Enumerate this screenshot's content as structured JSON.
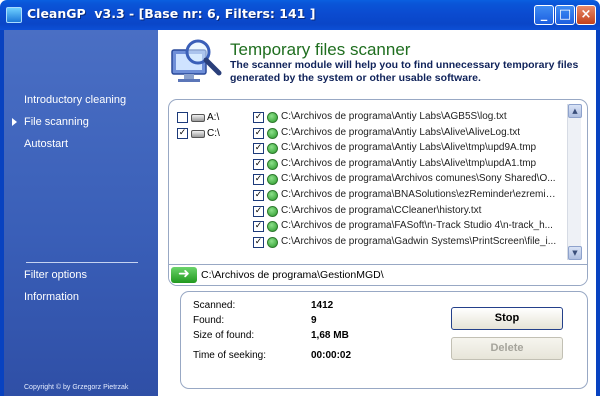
{
  "window": {
    "title": "CleanGP  v3.3 - [Base nr: 6, Filters: 141 ]",
    "min_label": "_",
    "max_label": "□",
    "close_label": "×"
  },
  "sidebar": {
    "items": [
      {
        "label": "Introductory cleaning",
        "active": false
      },
      {
        "label": "File scanning",
        "active": true
      },
      {
        "label": "Autostart",
        "active": false
      }
    ],
    "bottom_items": [
      {
        "label": "Filter options"
      },
      {
        "label": "Information"
      }
    ],
    "copyright": "Copyright © by Grzegorz Pietrzak"
  },
  "header": {
    "title": "Temporary files scanner",
    "description": "The scanner module will help you to find unnecessary temporary files generated by the system or other usable software."
  },
  "drives": [
    {
      "label": "A:\\",
      "checked": false
    },
    {
      "label": "C:\\",
      "checked": true
    }
  ],
  "files": [
    "C:\\Archivos de programa\\Antiy Labs\\AGB5S\\log.txt",
    "C:\\Archivos de programa\\Antiy Labs\\Alive\\AliveLog.txt",
    "C:\\Archivos de programa\\Antiy Labs\\Alive\\tmp\\upd9A.tmp",
    "C:\\Archivos de programa\\Antiy Labs\\Alive\\tmp\\updA1.tmp",
    "C:\\Archivos de programa\\Archivos comunes\\Sony Shared\\O...",
    "C:\\Archivos de programa\\BNASolutions\\ezReminder\\ezremin...",
    "C:\\Archivos de programa\\CCleaner\\history.txt",
    "C:\\Archivos de programa\\FASoft\\n-Track Studio 4\\n-track_h...",
    "C:\\Archivos de programa\\Gadwin Systems\\PrintScreen\\file_i..."
  ],
  "current_path": "C:\\Archivos de programa\\GestionMGD\\",
  "stats": {
    "scanned_label": "Scanned:",
    "scanned_value": "1412",
    "found_label": "Found:",
    "found_value": "9",
    "size_label": "Size of found:",
    "size_value": "1,68 MB",
    "time_label": "Time of seeking:",
    "time_value": "00:00:02"
  },
  "buttons": {
    "stop": "Stop",
    "delete": "Delete"
  },
  "colors": {
    "titlebar": "#0b4bd0",
    "sidebar": "#3a5fb8",
    "header_title": "#1f6e1f",
    "header_desc": "#10235a"
  }
}
